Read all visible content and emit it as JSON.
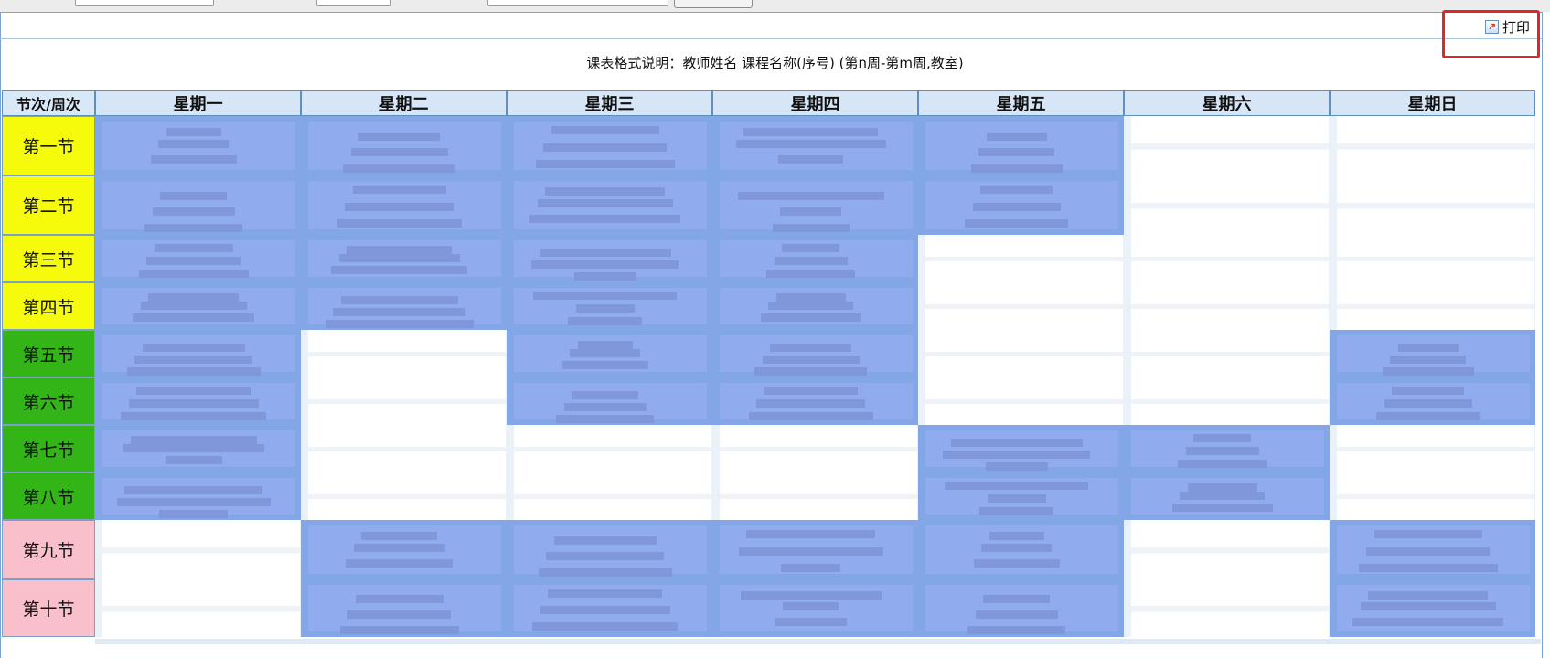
{
  "toolbar": {
    "print_label": "打印",
    "print_icon": "external-link-icon"
  },
  "legend": "课表格式说明：教师姓名 课程名称(序号) (第n周-第m周,教室)",
  "timetable": {
    "corner_label": "节次/周次",
    "days": [
      "星期一",
      "星期二",
      "星期三",
      "星期四",
      "星期五",
      "星期六",
      "星期日"
    ],
    "periods": [
      {
        "label": "第一节",
        "color": "#f5fb0a"
      },
      {
        "label": "第二节",
        "color": "#f5fb0a"
      },
      {
        "label": "第三节",
        "color": "#f5fb0a"
      },
      {
        "label": "第四节",
        "color": "#f5fb0a"
      },
      {
        "label": "第五节",
        "color": "#33b518"
      },
      {
        "label": "第六节",
        "color": "#33b518"
      },
      {
        "label": "第七节",
        "color": "#33b518"
      },
      {
        "label": "第八节",
        "color": "#33b518"
      },
      {
        "label": "第九节",
        "color": "#f9c0cc"
      },
      {
        "label": "第十节",
        "color": "#f9c0cc"
      }
    ],
    "course_cell_color": "#91acee",
    "occupied": [
      [
        true,
        true,
        true,
        true,
        true,
        false,
        false
      ],
      [
        true,
        true,
        true,
        true,
        true,
        false,
        false
      ],
      [
        true,
        true,
        true,
        true,
        false,
        false,
        false
      ],
      [
        true,
        true,
        true,
        true,
        false,
        false,
        false
      ],
      [
        true,
        false,
        true,
        true,
        false,
        false,
        true
      ],
      [
        true,
        false,
        true,
        true,
        false,
        false,
        true
      ],
      [
        true,
        false,
        false,
        false,
        true,
        true,
        false
      ],
      [
        true,
        false,
        false,
        false,
        true,
        true,
        false
      ],
      [
        false,
        true,
        true,
        true,
        true,
        false,
        true
      ],
      [
        false,
        true,
        true,
        true,
        true,
        false,
        true
      ]
    ]
  },
  "colors": {
    "header_bg": "#d6e6f6",
    "border": "#5f8fc0",
    "highlight_box": "#e0262b"
  }
}
